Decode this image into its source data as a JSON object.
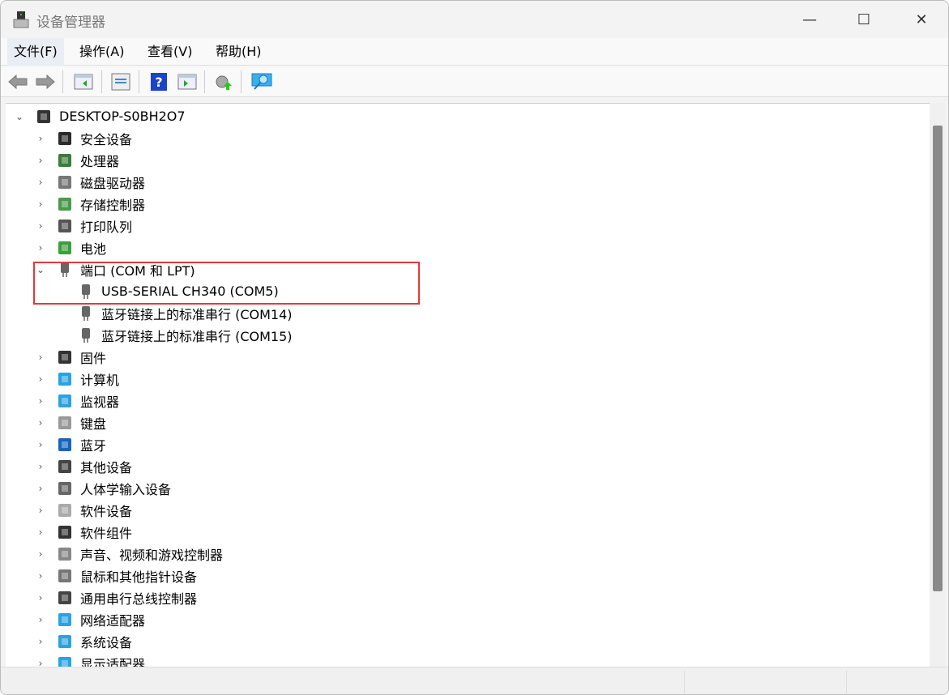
{
  "window": {
    "title": "设备管理器",
    "controls": [
      "minimize",
      "maximize",
      "close"
    ]
  },
  "menu": [
    "文件(F)",
    "操作(A)",
    "查看(V)",
    "帮助(H)"
  ],
  "toolbar": [
    "back-icon",
    "forward-icon",
    "show-hide-tree-icon",
    "properties-icon",
    "help-icon",
    "run-icon",
    "update-driver-icon",
    "scan-hardware-icon"
  ],
  "tree": {
    "root": "DESKTOP-S0BH2O7",
    "categories": [
      {
        "label": "安全设备",
        "icon": "security-device-icon",
        "color": "#2a2a2a"
      },
      {
        "label": "处理器",
        "icon": "processor-icon",
        "color": "#3a7d3a"
      },
      {
        "label": "磁盘驱动器",
        "icon": "disk-drive-icon",
        "color": "#777777"
      },
      {
        "label": "存储控制器",
        "icon": "storage-controller-icon",
        "color": "#4a9a4a"
      },
      {
        "label": "打印队列",
        "icon": "printer-icon",
        "color": "#555555"
      },
      {
        "label": "电池",
        "icon": "battery-icon",
        "color": "#3aa03a"
      },
      {
        "label": "端口 (COM 和 LPT)",
        "icon": "port-icon",
        "color": "#666666",
        "expanded": true,
        "children": [
          "USB-SERIAL CH340 (COM5)",
          "蓝牙链接上的标准串行 (COM14)",
          "蓝牙链接上的标准串行 (COM15)"
        ]
      },
      {
        "label": "固件",
        "icon": "firmware-icon",
        "color": "#333333"
      },
      {
        "label": "计算机",
        "icon": "computer-icon",
        "color": "#29a3e0"
      },
      {
        "label": "监视器",
        "icon": "monitor-icon",
        "color": "#29a3e0"
      },
      {
        "label": "键盘",
        "icon": "keyboard-icon",
        "color": "#999999"
      },
      {
        "label": "蓝牙",
        "icon": "bluetooth-icon",
        "color": "#1565c0"
      },
      {
        "label": "其他设备",
        "icon": "other-devices-icon",
        "color": "#444444"
      },
      {
        "label": "人体学输入设备",
        "icon": "hid-icon",
        "color": "#666666"
      },
      {
        "label": "软件设备",
        "icon": "software-device-icon",
        "color": "#aaaaaa"
      },
      {
        "label": "软件组件",
        "icon": "software-component-icon",
        "color": "#333333"
      },
      {
        "label": "声音、视频和游戏控制器",
        "icon": "sound-icon",
        "color": "#888888"
      },
      {
        "label": "鼠标和其他指针设备",
        "icon": "mouse-icon",
        "color": "#777777"
      },
      {
        "label": "通用串行总线控制器",
        "icon": "usb-icon",
        "color": "#444444"
      },
      {
        "label": "网络适配器",
        "icon": "network-adapter-icon",
        "color": "#29a3e0"
      },
      {
        "label": "系统设备",
        "icon": "system-device-icon",
        "color": "#29a3e0"
      },
      {
        "label": "显示适配器",
        "icon": "display-adapter-icon",
        "color": "#29a3e0"
      }
    ]
  },
  "highlight_color": "#e53935"
}
